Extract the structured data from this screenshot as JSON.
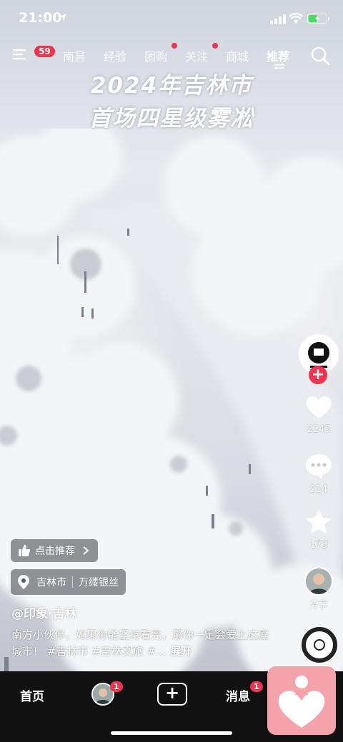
{
  "status_bar": {
    "time": "21:00"
  },
  "top_nav": {
    "menu_badge": "59",
    "tabs": [
      {
        "label": "南昌"
      },
      {
        "label": "经验"
      },
      {
        "label": "团购"
      },
      {
        "label": "关注"
      },
      {
        "label": "商城"
      },
      {
        "label": "推荐"
      }
    ]
  },
  "video": {
    "title_line1": "2024年吉林市",
    "title_line2": "首场四星级雾凇",
    "recommend_label": "点击推荐",
    "location": "吉林市",
    "location_tag": "万缕银丝",
    "author": "@印象·吉林",
    "caption": "南方小伙伴，如果你能坚持看完，那你一定会爱上这座城市！ #吉林市 #吉林文旅 #...",
    "expand_label": "展开"
  },
  "actions": {
    "likes": "2245",
    "comments": "214",
    "favorites": "173",
    "share_label": "分享"
  },
  "bottom_nav": {
    "home": "首页",
    "friend_badge": "1",
    "plus": "+",
    "messages": "消息",
    "messages_badge": "1"
  },
  "colors": {
    "accent": "#f0334f",
    "float_heart_bg": "#f5a3ab"
  }
}
